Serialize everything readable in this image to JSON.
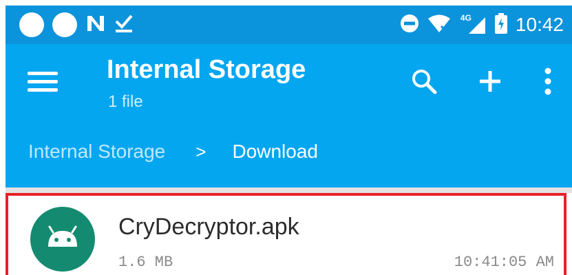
{
  "status_bar": {
    "time": "10:42",
    "network_type": "4G",
    "left_icons": [
      "notification-dot-icon",
      "notification-dot-icon",
      "n-app-icon",
      "download-done-icon"
    ],
    "right_icons": [
      "do-not-disturb-icon",
      "wifi-icon",
      "signal-icon",
      "battery-charging-icon"
    ]
  },
  "app_bar": {
    "title": "Internal Storage",
    "subtitle": "1 file",
    "breadcrumb": {
      "root": "Internal Storage",
      "separator": ">",
      "current": "Download"
    },
    "actions": [
      "search-icon",
      "add-icon",
      "more-vert-icon"
    ],
    "color": "#04a6f0"
  },
  "files": [
    {
      "name": "CryDecryptor.apk",
      "size": "1.6 MB",
      "time": "10:41:05 AM",
      "icon": "android-icon",
      "icon_color": "#148b70",
      "highlight_color": "#e8202a"
    }
  ]
}
